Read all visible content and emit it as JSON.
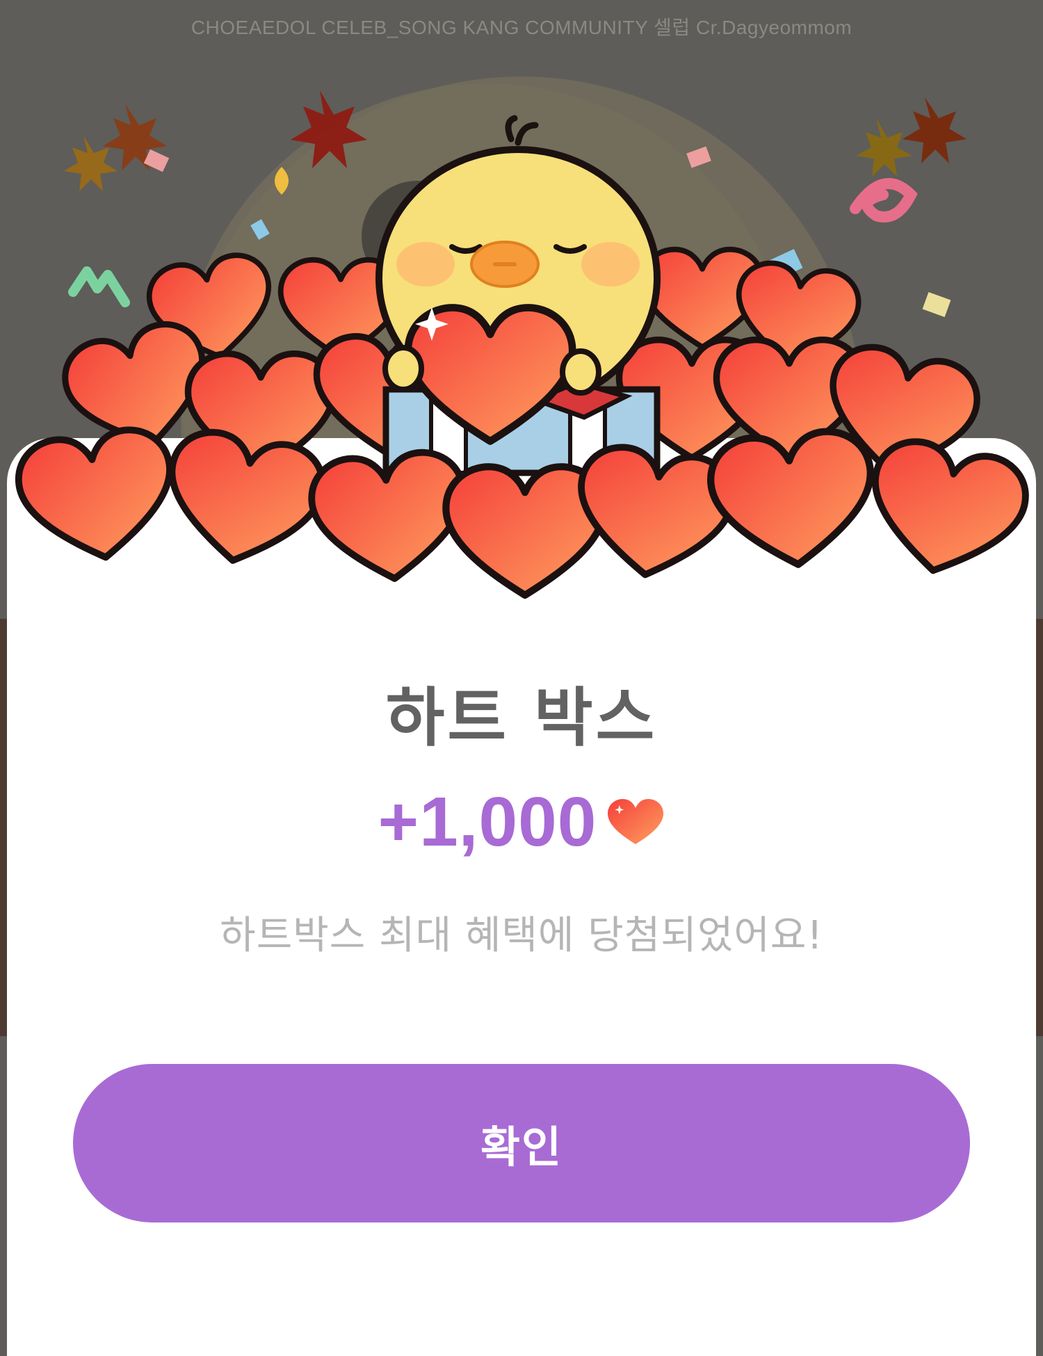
{
  "background": {
    "credit_text": "CHOEAEDOL CELEB_SONG KANG COMMUNITY 셀럽 Cr.Dagyeommom"
  },
  "popup": {
    "title": "하트 박스",
    "reward_amount": "+1,000",
    "reward_icon": "heart-icon",
    "message": "하트박스 최대 혜택에 당첨되었어요!",
    "confirm_label": "확인"
  },
  "colors": {
    "accent": "#a86bd4",
    "title": "#626262",
    "message": "#b5b5b5"
  }
}
